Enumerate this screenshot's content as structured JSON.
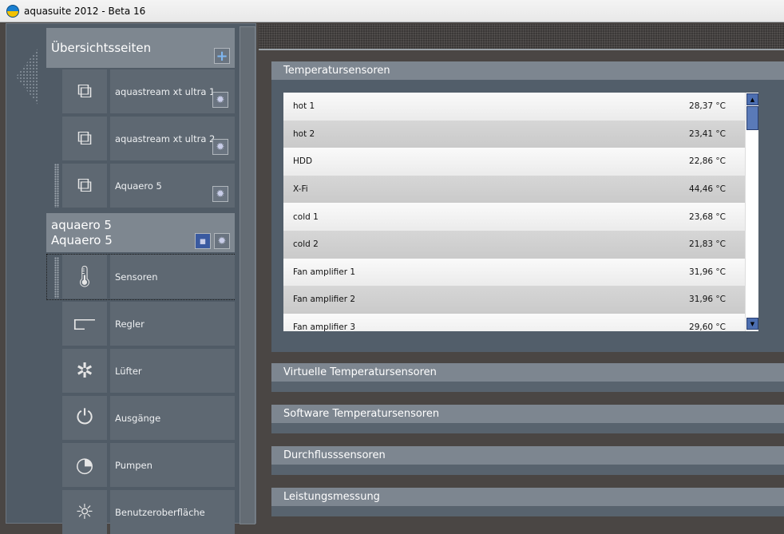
{
  "window": {
    "title": "aquasuite 2012 - Beta 16"
  },
  "sidebar": {
    "overview_header": "Übersichtsseiten",
    "add_icon": "plus-icon",
    "overview_items": [
      {
        "label": "aquastream xt ultra 1",
        "icon": "pages-icon"
      },
      {
        "label": "aquastream xt ultra 2",
        "icon": "pages-icon"
      },
      {
        "label": "Aquaero 5",
        "icon": "pages-icon"
      }
    ],
    "device_header_line1": "aquaero 5",
    "device_header_line2": "Aquaero 5",
    "nav_items": [
      {
        "label": "Sensoren",
        "icon": "thermometer-icon",
        "selected": true
      },
      {
        "label": "Regler",
        "icon": "controller-icon"
      },
      {
        "label": "Lüfter",
        "icon": "fan-icon"
      },
      {
        "label": "Ausgänge",
        "icon": "plug-icon"
      },
      {
        "label": "Pumpen",
        "icon": "pump-icon"
      },
      {
        "label": "Benutzeroberfläche",
        "icon": "brightness-icon"
      }
    ]
  },
  "main": {
    "temp_panel": {
      "title": "Temperatursensoren",
      "sensors": [
        {
          "name": "hot 1",
          "value": "28,37 °C"
        },
        {
          "name": "hot 2",
          "value": "23,41 °C"
        },
        {
          "name": "HDD",
          "value": "22,86 °C"
        },
        {
          "name": "X-Fi",
          "value": "44,46 °C"
        },
        {
          "name": "cold 1",
          "value": "23,68 °C"
        },
        {
          "name": "cold 2",
          "value": "21,83 °C"
        },
        {
          "name": "Fan amplifier 1",
          "value": "31,96 °C"
        },
        {
          "name": "Fan amplifier 2",
          "value": "31,96 °C"
        },
        {
          "name": "Fan amplifier 3",
          "value": "29,60 °C"
        }
      ]
    },
    "collapsed_panels": [
      "Virtuelle Temperatursensoren",
      "Software Temperatursensoren",
      "Durchflusssensoren",
      "Leistungsmessung"
    ]
  }
}
